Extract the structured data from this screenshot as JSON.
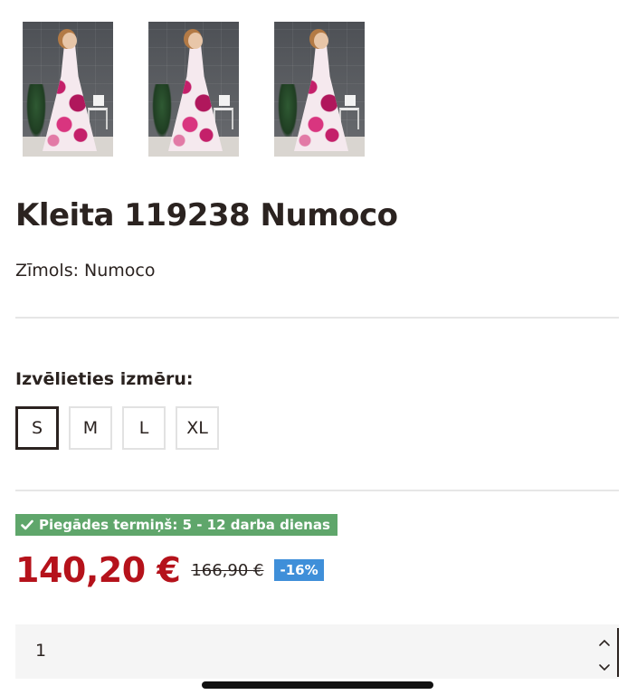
{
  "gallery": {
    "images": [
      {
        "alt": "dress-front"
      },
      {
        "alt": "dress-pose"
      },
      {
        "alt": "dress-back"
      }
    ]
  },
  "product": {
    "title": "Kleita 119238 Numoco",
    "brand": "Zīmols: Numoco"
  },
  "size_selector": {
    "label": "Izvēlieties izmēru:",
    "options": [
      "S",
      "M",
      "L",
      "XL"
    ],
    "selected": "S"
  },
  "delivery": {
    "text": "Piegādes termiņš: 5 - 12 darba dienas",
    "color": "#5fa66b",
    "icon": "check-icon"
  },
  "pricing": {
    "price": "140,20 €",
    "old_price": "166,90 €",
    "discount": "-16%",
    "price_color": "#b5121b",
    "discount_color": "#3f8fd9"
  },
  "quantity": {
    "value": "1"
  }
}
